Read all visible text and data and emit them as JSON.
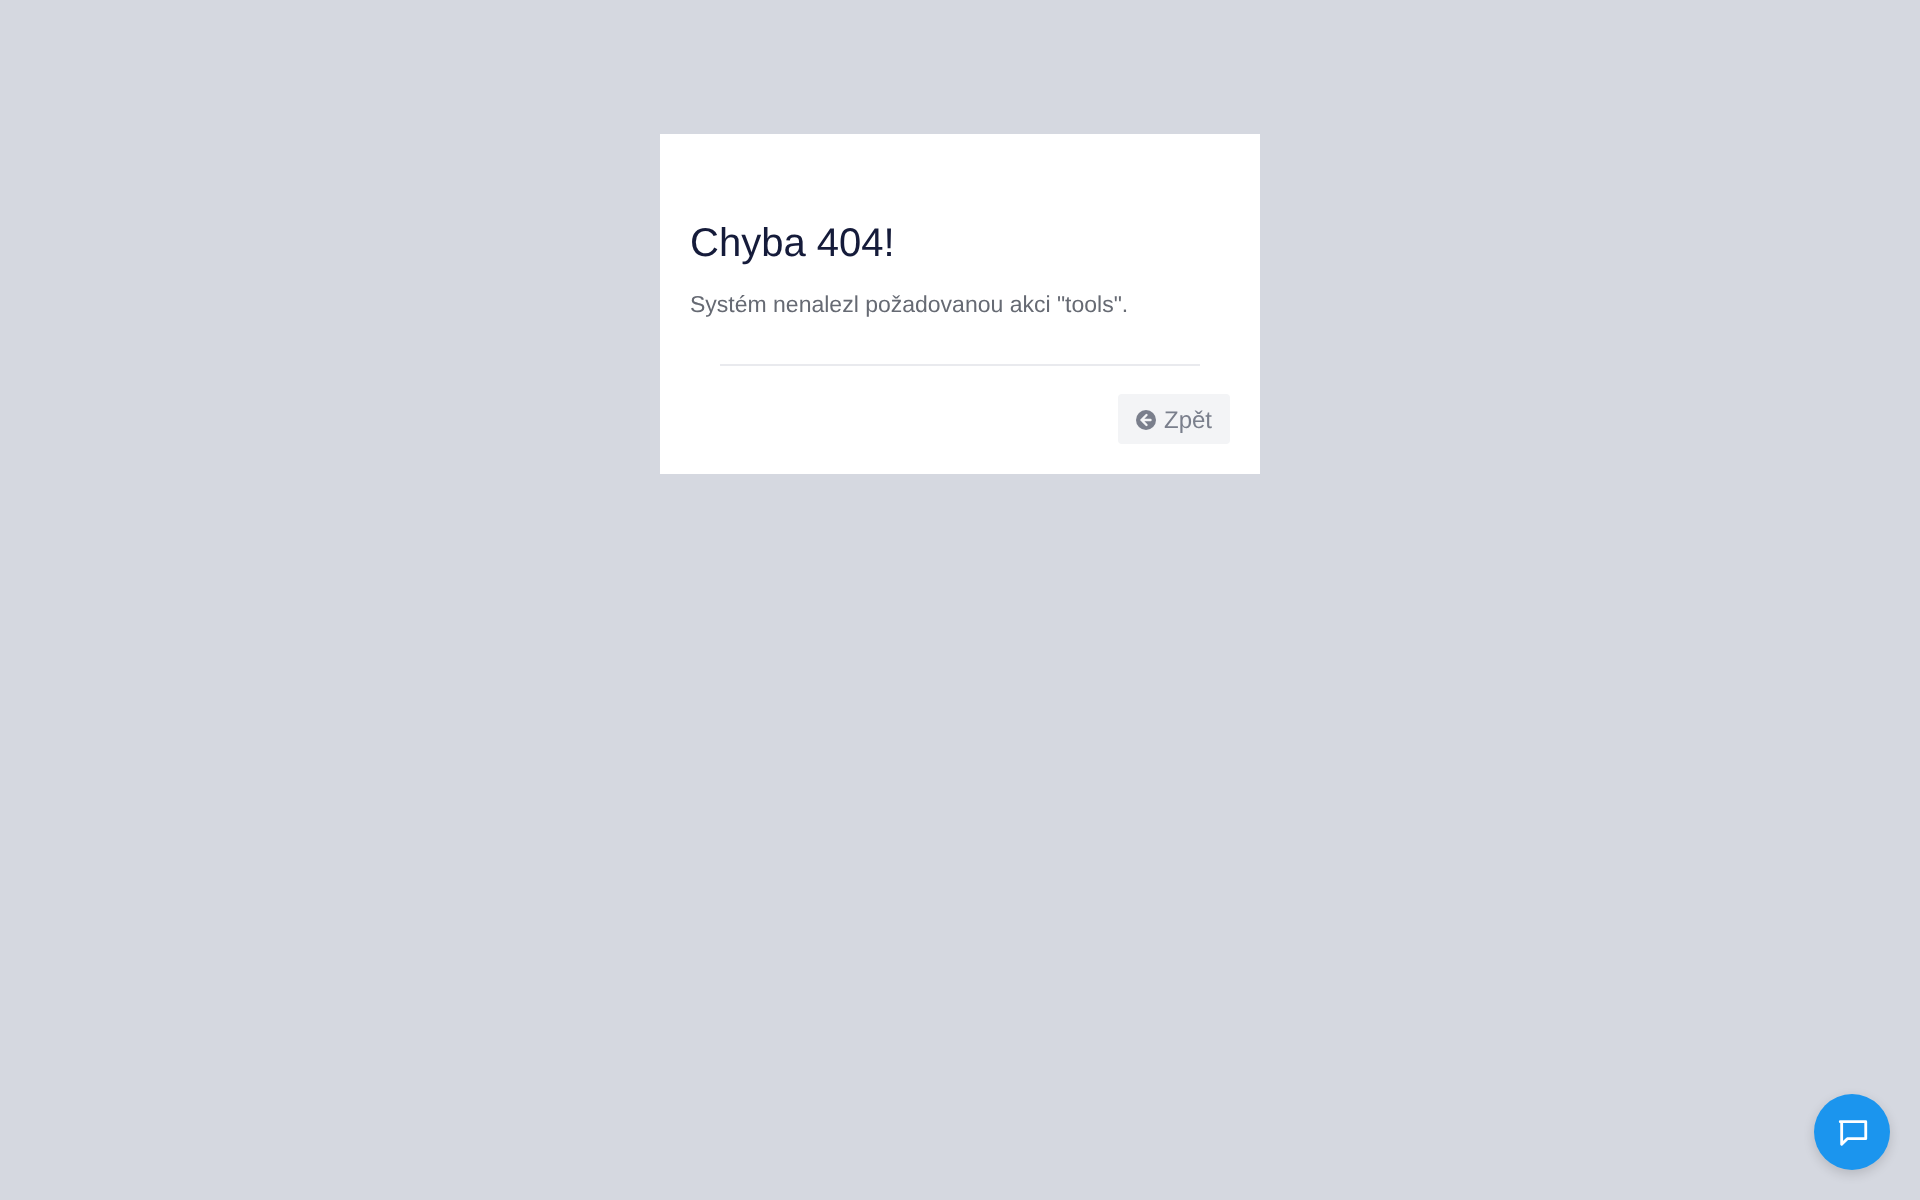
{
  "dialog": {
    "title": "Chyba 404!",
    "message": "Systém nenalezl požadovanou akci \"tools\".",
    "buttons": [
      {
        "kind": "back",
        "label": "Zpět"
      }
    ]
  },
  "chat_button": {
    "kind": "chat"
  }
}
